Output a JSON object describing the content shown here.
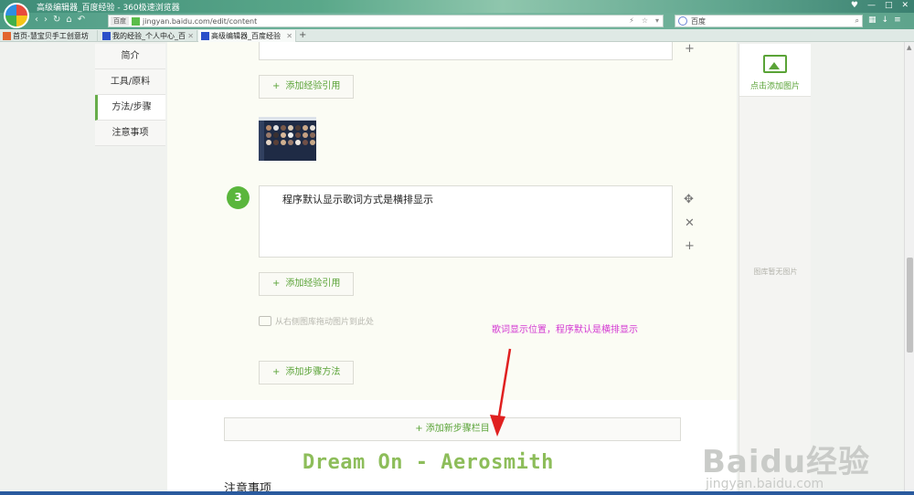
{
  "window": {
    "title": "高级编辑器_百度经验 - 360极速浏览器"
  },
  "address_bar": {
    "site_label": "百度",
    "url": "jingyan.baidu.com/edit/content"
  },
  "search_box": {
    "engine": "百度"
  },
  "tabs": [
    {
      "label": "首页-慧宝贝手工创意坊",
      "active": false
    },
    {
      "label": "我的经验_个人中心_百",
      "active": false
    },
    {
      "label": "高级编辑器_百度经验",
      "active": true
    }
  ],
  "sidebar": {
    "items": [
      {
        "label": "简介",
        "active": false
      },
      {
        "label": "工具/原料",
        "active": false
      },
      {
        "label": "方法/步骤",
        "active": true
      },
      {
        "label": "注意事项",
        "active": false
      }
    ]
  },
  "editor": {
    "cite_button": "添加经验引用",
    "step": {
      "number": "3",
      "text": "程序默认显示歌词方式是横排显示"
    },
    "drag_hint": "从右侧图库拖动图片到此处",
    "add_method_button": "添加步骤方法",
    "add_section_button": "添加新步骤栏目",
    "lyric": "Dream On - Aerosmith",
    "notes_title": "注意事项"
  },
  "annotation": {
    "text": "歌词显示位置，程序默认是横排显示",
    "color": "#d337d2"
  },
  "right_panel": {
    "add_image": "点击添加图片",
    "empty_text": "图库暂无图片"
  },
  "watermark": {
    "brand": "Baidu经验",
    "url": "jingyan.baidu.com"
  },
  "colors": {
    "accent": "#5aa337",
    "step_badge": "#5ab63c",
    "lyric": "#8dbd5a"
  }
}
